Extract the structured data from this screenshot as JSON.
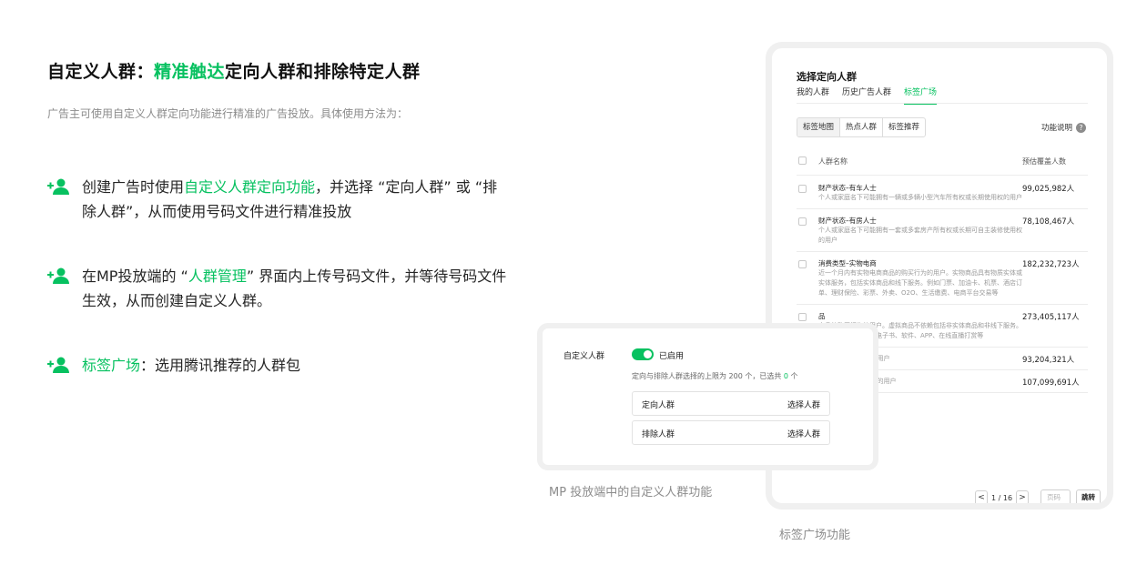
{
  "heading": {
    "part1": "自定义人群：",
    "highlight": "精准触达",
    "part2": "定向人群和排除特定人群"
  },
  "subtitle": "广告主可使用自定义人群定向功能进行精准的广告投放。具体使用方法为：",
  "bullets": [
    {
      "icon": "add-user-icon",
      "pre": "创建广告时使用",
      "link": "自定义人群定向功能",
      "post": "，并选择 “定向人群” 或 “排除人群”，从而使用号码文件进行精准投放"
    },
    {
      "icon": "add-user-icon",
      "pre": "在MP投放端的 “",
      "link": "人群管理",
      "post": "” 界面内上传号码文件，并等待号码文件生效，从而创建自定义人群。"
    },
    {
      "icon": "add-user-icon",
      "pre": "",
      "link": "标签广场",
      "post": "：选用腾讯推荐的人群包"
    }
  ],
  "tag_panel": {
    "title": "选择定向人群",
    "tabs": [
      "我的人群",
      "历史广告人群",
      "标签广场"
    ],
    "active_tab": 2,
    "segments": [
      "标签地图",
      "热点人群",
      "标签推荐"
    ],
    "help": "功能说明",
    "columns": [
      "人群名称",
      "预估覆盖人数"
    ],
    "rows": [
      {
        "name": "财产状态–有车人士",
        "desc": "个人或家庭名下可能拥有一辆或多辆小型汽车所有权或长期使用权的用户",
        "count": "99,025,982人"
      },
      {
        "name": "财产状态–有房人士",
        "desc": "个人或家庭名下可能拥有一套或多套房产所有权或长期可自主装修使用权的用户",
        "count": "78,108,467人"
      },
      {
        "name": "消费类型–实物电商",
        "desc": "近一个月内有实物电商商品的购买行为的用户。实物商品具有物质实体或实体服务，包括实体商品和线下服务。例如门票、加油卡、机票、酒店订单、理财保险、彩票、外卖、O2O、生活缴费、电商平台交易等",
        "count": "182,232,723人"
      },
      {
        "name": "品",
        "desc": "商品的购买行为的用户。虚拟商品不依赖包括非实体商品和非线下服务。例如话、游戏点卡、电子书、软件、APP、在线直播打赏等",
        "count": "273,405,117人"
      },
      {
        "name": "",
        "desc": "国用户中占后30%的用户",
        "count": "93,204,321人"
      },
      {
        "name": "",
        "desc": "国用户中占最前30%的用户",
        "count": "107,099,691人"
      }
    ],
    "pager": {
      "prev": "<",
      "page": "1 / 16",
      "next": ">",
      "input_placeholder": "页码",
      "jump": "跳转"
    },
    "caption": "标签广场功能"
  },
  "mp_panel": {
    "label": "自定义人群",
    "status": "已启用",
    "toggle_on": true,
    "limit_pre": "定向与排除人群选择的上限为 200 个，已选共 ",
    "limit_count": "0",
    "limit_post": " 个",
    "boxes": [
      {
        "label": "定向人群",
        "action": "选择人群"
      },
      {
        "label": "排除人群",
        "action": "选择人群"
      }
    ],
    "caption": "MP 投放端中的自定义人群功能"
  },
  "colors": {
    "accent": "#07c160",
    "muted": "#8c8c8c",
    "frame": "#f0f0f0"
  }
}
